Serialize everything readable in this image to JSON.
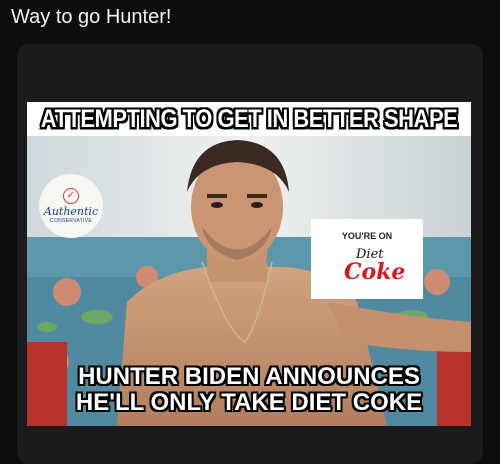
{
  "post": {
    "text": "Way to go Hunter!"
  },
  "meme": {
    "top_caption": "ATTEMPTING TO GET IN BETTER SHAPE",
    "bottom_caption_line1": "HUNTER BIDEN ANNOUNCES",
    "bottom_caption_line2": "HE'LL ONLY TAKE DIET COKE",
    "logo": {
      "name": "Authentic",
      "sub": "CONSERVATIVE"
    },
    "inset": {
      "label": "YOU'RE ON",
      "diet": "Diet",
      "brand": "Coke"
    }
  },
  "colors": {
    "background": "#0d0d0e",
    "card": "#1b1b1d",
    "coke_red": "#d71920",
    "logo_blue": "#1d3b8f"
  }
}
